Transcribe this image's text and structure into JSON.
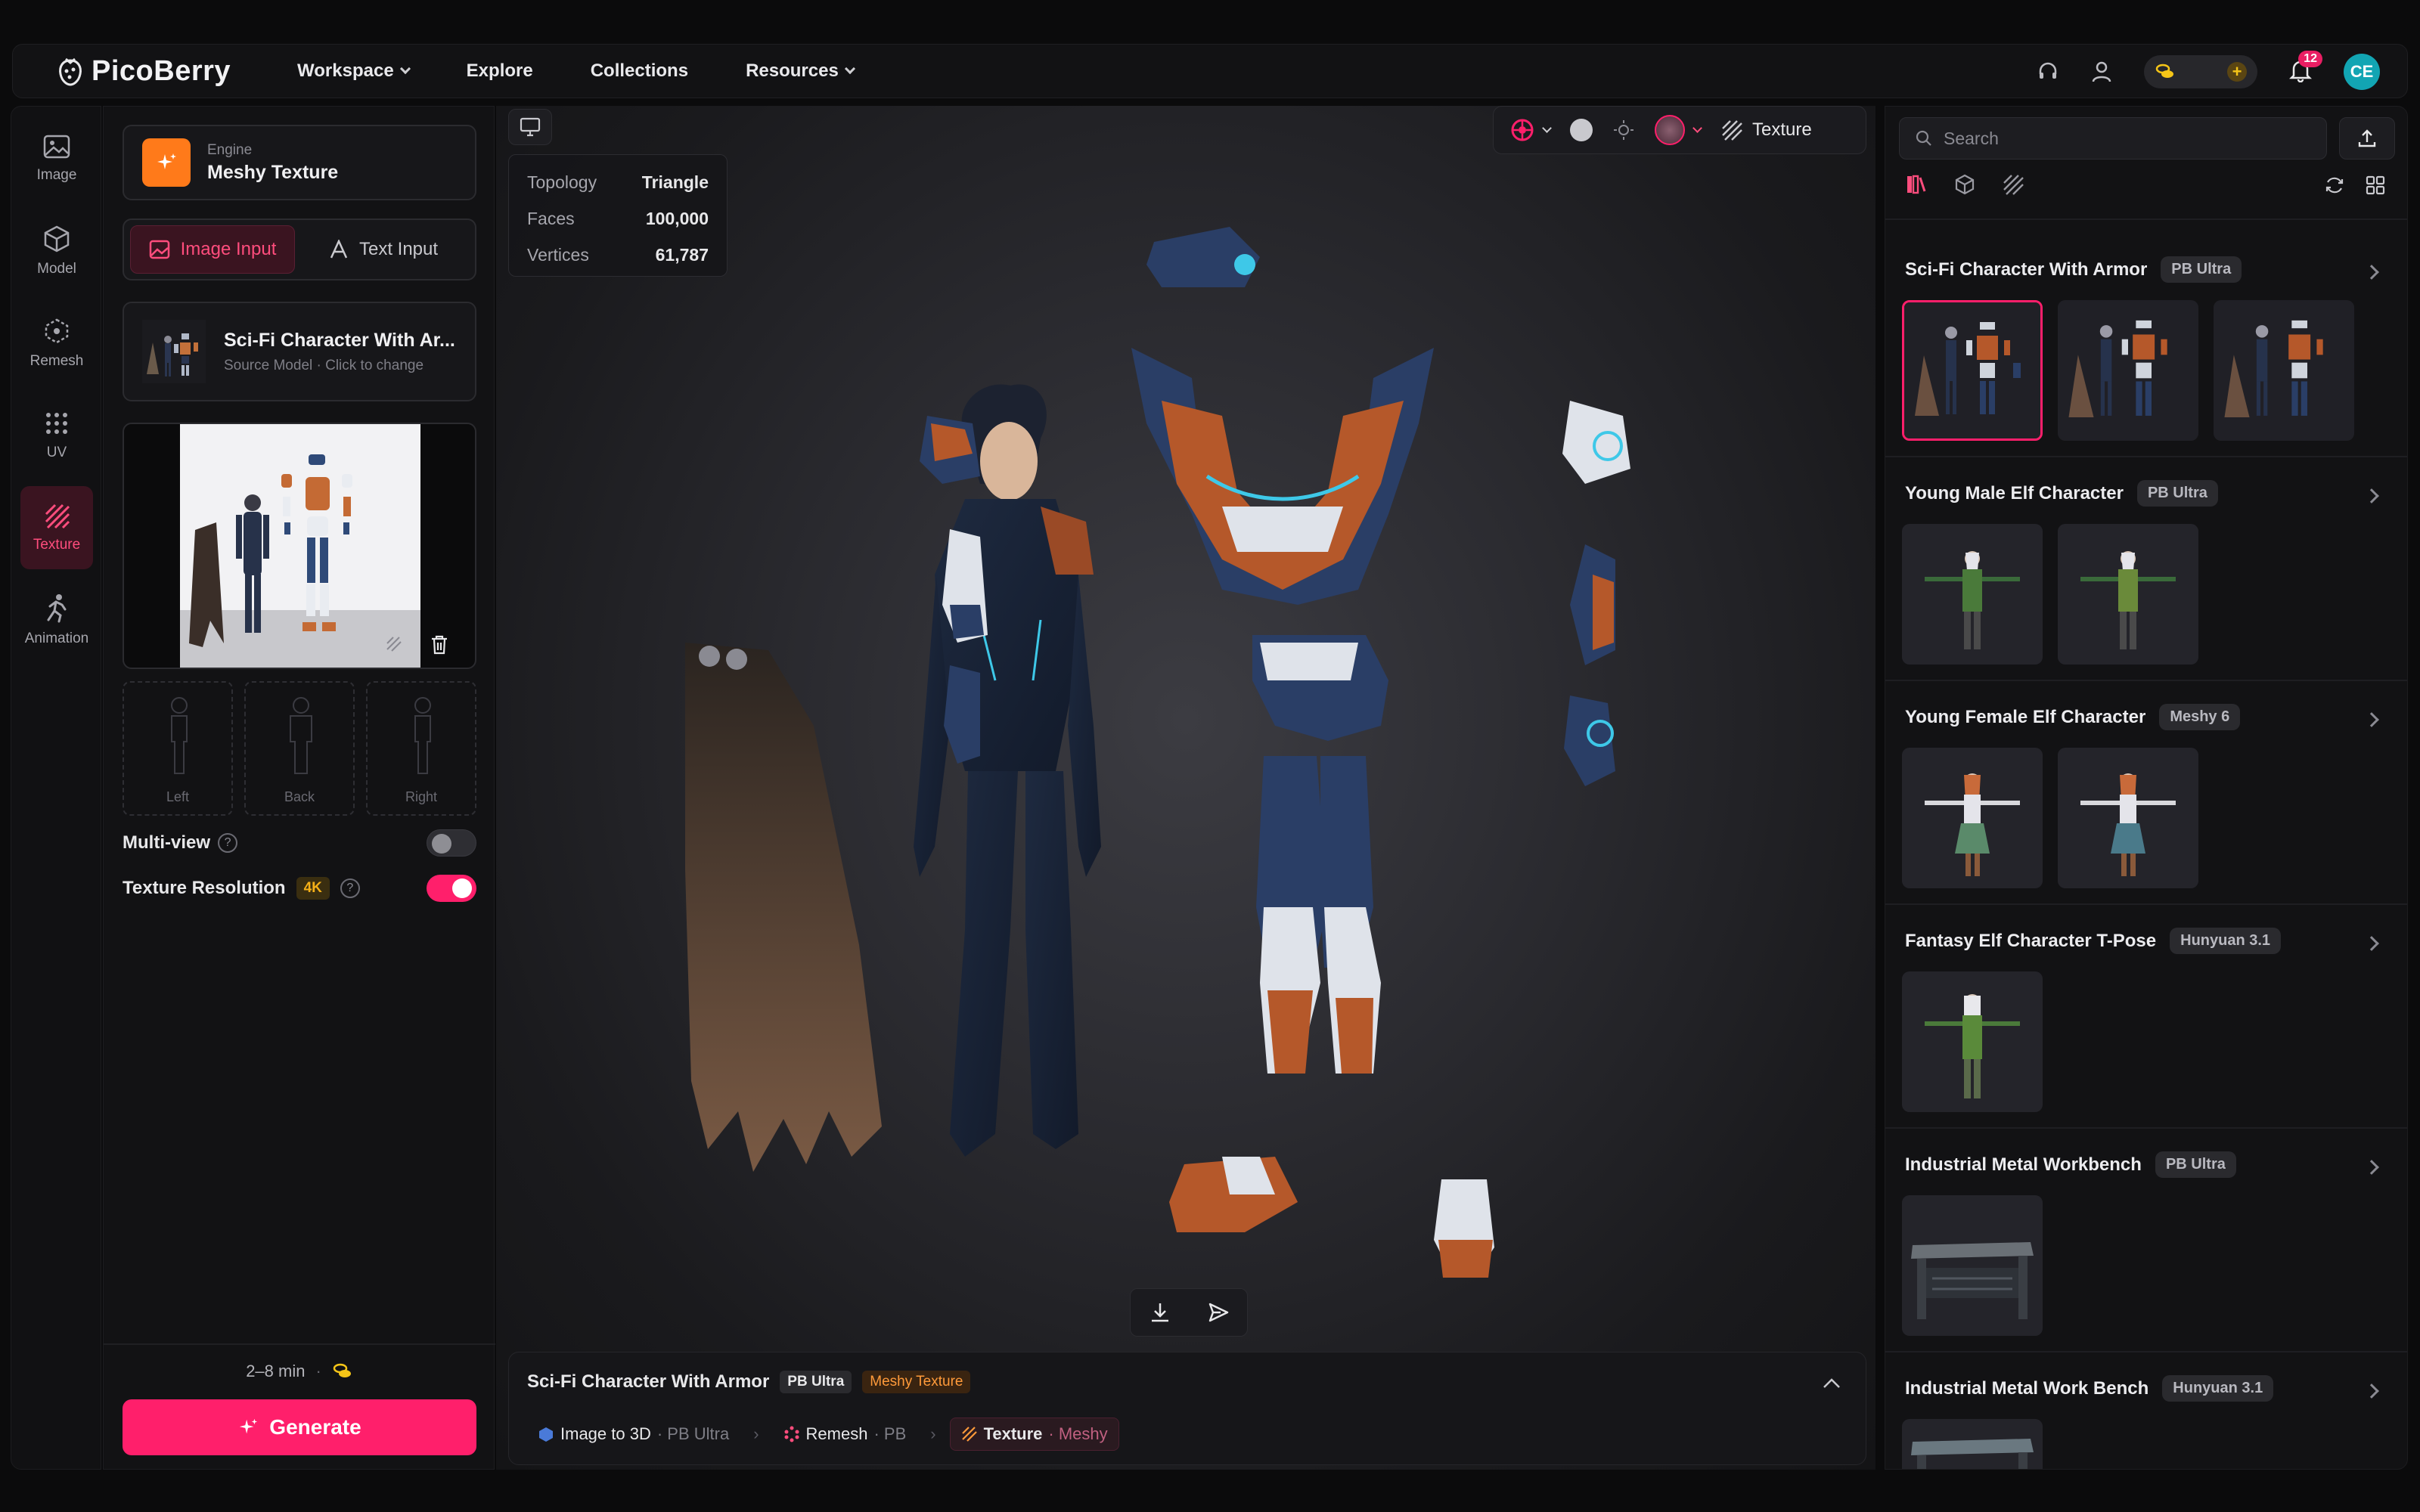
{
  "brand": {
    "name": "PicoBerry"
  },
  "nav": {
    "workspace": "Workspace",
    "explore": "Explore",
    "collections": "Collections",
    "resources": "Resources"
  },
  "topbar": {
    "notification_count": "12",
    "avatar_initials": "CE"
  },
  "rail": [
    {
      "label": "Image",
      "icon": "image-icon"
    },
    {
      "label": "Model",
      "icon": "cube-icon"
    },
    {
      "label": "Remesh",
      "icon": "remesh-icon"
    },
    {
      "label": "UV",
      "icon": "grid-dots-icon"
    },
    {
      "label": "Texture",
      "icon": "texture-icon",
      "active": true
    },
    {
      "label": "Animation",
      "icon": "running-figure-icon"
    }
  ],
  "left": {
    "engine_caption": "Engine",
    "engine_name": "Meshy Texture",
    "tab_image": "Image Input",
    "tab_text": "Text Input",
    "source_title": "Sci-Fi Character With Ar...",
    "source_sub": "Source Model · Click to change",
    "views": [
      "Left",
      "Back",
      "Right"
    ],
    "multiview_label": "Multi-view",
    "texres_label": "Texture Resolution",
    "texres_badge": "4K",
    "time_estimate": "2–8 min",
    "generate_label": "Generate"
  },
  "viewport": {
    "stats": [
      {
        "label": "Topology",
        "value": "Triangle"
      },
      {
        "label": "Faces",
        "value": "100,000"
      },
      {
        "label": "Vertices",
        "value": "61,787"
      }
    ],
    "mode_label": "Texture",
    "bottom_title": "Sci-Fi Character With Armor",
    "bottom_badge1": "PB Ultra",
    "bottom_badge2": "Meshy Texture",
    "pipeline": [
      {
        "step": "Image to 3D",
        "sub": "· PB Ultra"
      },
      {
        "step": "Remesh",
        "sub": "· PB"
      },
      {
        "step": "Texture",
        "sub": "· Meshy"
      }
    ]
  },
  "right": {
    "search_placeholder": "Search",
    "groups": [
      {
        "title": "Sci-Fi Character With Armor",
        "badge": "PB Ultra",
        "count": 3
      },
      {
        "title": "Young Male Elf Character",
        "badge": "PB Ultra",
        "count": 2
      },
      {
        "title": "Young Female Elf Character",
        "badge": "Meshy 6",
        "count": 2
      },
      {
        "title": "Fantasy Elf Character T-Pose",
        "badge": "Hunyuan 3.1",
        "count": 1
      },
      {
        "title": "Industrial Metal Workbench",
        "badge": "PB Ultra",
        "count": 1
      },
      {
        "title": "Industrial Metal Work Bench",
        "badge": "Hunyuan 3.1",
        "count": 1
      }
    ]
  },
  "colors": {
    "accent": "#ff1f6b",
    "engine_orange": "#ff7a1a",
    "armor_blue": "#1f3556",
    "armor_orange": "#b5582a"
  }
}
